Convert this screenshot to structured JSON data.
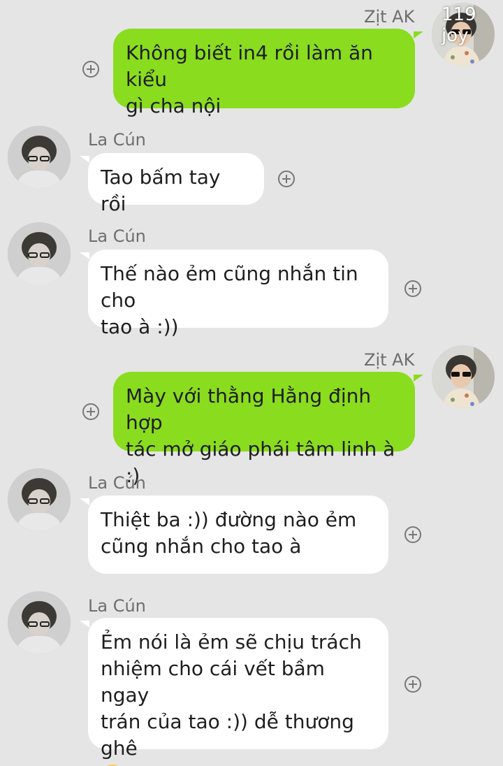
{
  "watermark": "119 joy",
  "colors": {
    "background": "#e5e5e5",
    "outgoing_bubble": "#8adc1f",
    "incoming_bubble": "#ffffff",
    "name_text": "#6e6e6e"
  },
  "messages": [
    {
      "sender": "Zịt AK",
      "direction": "outgoing",
      "lines": [
        "Không biết in4 rồi làm ăn kiểu",
        "gì cha nội"
      ]
    },
    {
      "sender": "La Cún",
      "direction": "incoming",
      "lines": [
        "Tao bấm tay rồi"
      ]
    },
    {
      "sender": "La Cún",
      "direction": "incoming",
      "lines": [
        "Thế nào ẻm cũng nhắn tin cho",
        "tao à :))"
      ]
    },
    {
      "sender": "Zịt AK",
      "direction": "outgoing",
      "lines": [
        "Mày với thằng Hằng định hợp",
        "tác mở giáo phái tâm linh à :)"
      ]
    },
    {
      "sender": "La Cún",
      "direction": "incoming",
      "lines": [
        "Thiệt ba :)) đường nào ẻm",
        "cũng nhắn cho tao à"
      ]
    },
    {
      "sender": "La Cún",
      "direction": "incoming",
      "lines": [
        "Ẻm nói là ẻm sẽ chịu trách",
        "nhiệm cho cái vết bầm ngay",
        "trán của tao :)) dễ thương ghê"
      ],
      "emoji": "flushed-face-emoji"
    }
  ],
  "icons": {
    "reaction": "add-reaction-icon",
    "avatar": "user-avatar"
  }
}
